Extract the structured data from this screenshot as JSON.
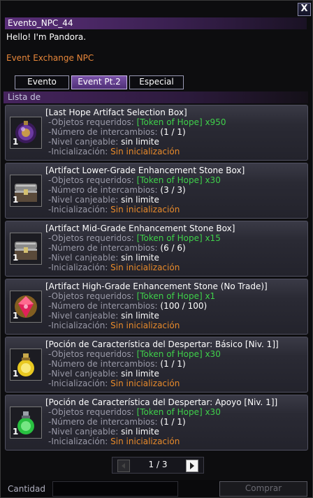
{
  "window": {
    "close_glyph": "X"
  },
  "npc": {
    "title": "Evento_NPC_44",
    "greeting": "Hello! I'm Pandora.",
    "role": "Event Exchange NPC"
  },
  "tabs": [
    {
      "label": "Evento",
      "active": false
    },
    {
      "label": "Event Pt.2",
      "active": true
    },
    {
      "label": "Especial",
      "active": false
    }
  ],
  "list_header": "Lista de",
  "field_labels": {
    "required": "-Objetos requeridos:",
    "exchanges": "-Número de intercambios:",
    "level": "-Nivel canjeable:",
    "reset": "-Inicialización:"
  },
  "items": [
    {
      "icon": "purple-orb-icon",
      "qty": "1",
      "name": "[Last Hope Artifact Selection Box]",
      "token": "[Token of Hope] x950",
      "exchanges": "(1 / 1)",
      "level": "sin limite",
      "reset": "Sin inicialización"
    },
    {
      "icon": "treasure-chest-icon",
      "qty": "1",
      "name": "[Artifact Lower-Grade Enhancement Stone Box]",
      "token": "[Token of Hope] x30",
      "exchanges": "(3 / 3)",
      "level": "sin limite",
      "reset": "Sin inicialización"
    },
    {
      "icon": "treasure-chest-icon",
      "qty": "1",
      "name": "[Artifact Mid-Grade Enhancement Stone Box]",
      "token": "[Token of Hope] x15",
      "exchanges": "(6 / 6)",
      "level": "sin limite",
      "reset": "Sin inicialización"
    },
    {
      "icon": "red-gem-icon",
      "qty": "1",
      "name": "[Artifact High-Grade Enhancement Stone (No Trade)]",
      "token": "[Token of Hope] x1",
      "exchanges": "(100 / 100)",
      "level": "sin limite",
      "reset": "Sin inicialización"
    },
    {
      "icon": "yellow-potion-icon",
      "qty": "1",
      "name": "[Poción de Característica del Despertar: Básico [Niv. 1]]",
      "token": "[Token of Hope] x30",
      "exchanges": "(1 / 1)",
      "level": "sin limite",
      "reset": "Sin inicialización"
    },
    {
      "icon": "green-potion-icon",
      "qty": "1",
      "name": "[Poción de Característica del Despertar: Apoyo [Niv. 1]]",
      "token": "[Token of Hope] x30",
      "exchanges": "(1 / 1)",
      "level": "sin limite",
      "reset": "Sin inicialización"
    }
  ],
  "pagination": {
    "text": "1 / 3"
  },
  "footer": {
    "quantity_label": "Cantidad",
    "buy_label": "Comprar"
  }
}
